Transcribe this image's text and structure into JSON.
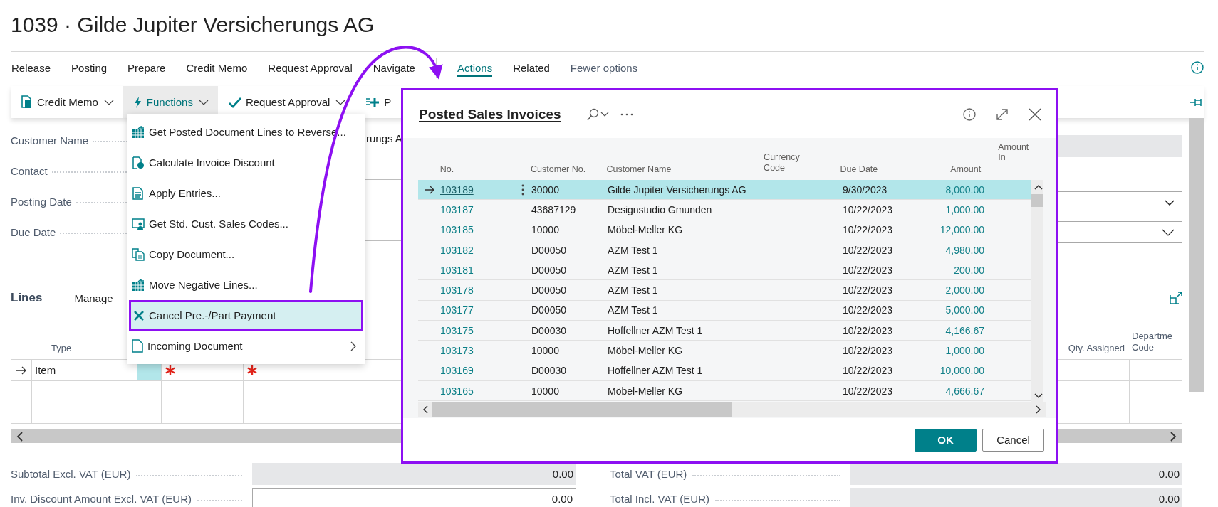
{
  "page_title": "1039 · Gilde Jupiter Versicherungs AG",
  "promoted_actions": [
    "Release",
    "Posting",
    "Prepare",
    "Credit Memo",
    "Request Approval",
    "Navigate"
  ],
  "action_tabs": [
    {
      "label": "Actions",
      "selected": true
    },
    {
      "label": "Related",
      "selected": false
    }
  ],
  "fewer_options": "Fewer options",
  "toolbar": [
    {
      "label": "Credit Memo",
      "selected": false,
      "dropdown": true
    },
    {
      "label": "Functions",
      "selected": true,
      "dropdown": true
    },
    {
      "label": "Request Approval",
      "selected": false,
      "dropdown": true
    },
    {
      "label": "P",
      "selected": false,
      "dropdown": false
    }
  ],
  "functions_menu": [
    {
      "label": "Get Posted Document Lines to Reverse...",
      "selected": false,
      "submenu": false
    },
    {
      "label": "Calculate Invoice Discount",
      "selected": false,
      "submenu": false
    },
    {
      "label": "Apply Entries...",
      "selected": false,
      "submenu": false
    },
    {
      "label": "Get Std. Cust. Sales Codes...",
      "selected": false,
      "submenu": false
    },
    {
      "label": "Copy Document...",
      "selected": false,
      "submenu": false
    },
    {
      "label": "Move Negative Lines...",
      "selected": false,
      "submenu": false
    },
    {
      "label": "Cancel Pre.-/Part Payment",
      "selected": true,
      "submenu": false
    },
    {
      "label": "Incoming Document",
      "selected": false,
      "submenu": true
    }
  ],
  "general_fields": [
    {
      "label": "Customer Name",
      "value": "rungs A"
    },
    {
      "label": "Contact"
    },
    {
      "label": "Posting Date"
    },
    {
      "label": "Due Date"
    }
  ],
  "lines": {
    "title": "Lines",
    "manage": "Manage",
    "type_column": "Type",
    "right_columns": [
      "Qty. Assigned",
      "Departme Code"
    ],
    "rows": [
      {
        "type": "Item",
        "selected": true
      }
    ]
  },
  "totals": [
    {
      "label": "Subtotal Excl. VAT (EUR)",
      "value": "0.00",
      "editable": false
    },
    {
      "label": "Total VAT (EUR)",
      "value": "0.00",
      "editable": false
    },
    {
      "label": "Inv. Discount Amount Excl. VAT (EUR)",
      "value": "0.00",
      "editable": true
    },
    {
      "label": "Total Incl. VAT (EUR)",
      "value": "0.00",
      "editable": false
    }
  ],
  "dialog": {
    "title": "Posted Sales Invoices",
    "columns": [
      "No.",
      "Customer No.",
      "Customer Name",
      "Currency Code",
      "Due Date",
      "Amount",
      "Amount In"
    ],
    "rows": [
      {
        "no": "103189",
        "customer_no": "30000",
        "customer_name": "Gilde Jupiter Versicherungs AG",
        "due_date": "9/30/2023",
        "amount": "8,000.00",
        "selected": true
      },
      {
        "no": "103187",
        "customer_no": "43687129",
        "customer_name": "Designstudio Gmunden",
        "due_date": "10/22/2023",
        "amount": "1,000.00",
        "selected": false
      },
      {
        "no": "103185",
        "customer_no": "10000",
        "customer_name": "Möbel-Meller KG",
        "due_date": "10/22/2023",
        "amount": "12,000.00",
        "selected": false
      },
      {
        "no": "103182",
        "customer_no": "D00050",
        "customer_name": "AZM Test 1",
        "due_date": "10/22/2023",
        "amount": "4,980.00",
        "selected": false
      },
      {
        "no": "103181",
        "customer_no": "D00050",
        "customer_name": "AZM Test 1",
        "due_date": "10/22/2023",
        "amount": "200.00",
        "selected": false
      },
      {
        "no": "103178",
        "customer_no": "D00050",
        "customer_name": "AZM Test 1",
        "due_date": "10/22/2023",
        "amount": "2,000.00",
        "selected": false
      },
      {
        "no": "103177",
        "customer_no": "D00050",
        "customer_name": "AZM Test 1",
        "due_date": "10/22/2023",
        "amount": "5,000.00",
        "selected": false
      },
      {
        "no": "103175",
        "customer_no": "D00030",
        "customer_name": "Hoffellner AZM Test 1",
        "due_date": "10/22/2023",
        "amount": "4,166.67",
        "selected": false
      },
      {
        "no": "103173",
        "customer_no": "10000",
        "customer_name": "Möbel-Meller KG",
        "due_date": "10/22/2023",
        "amount": "1,000.00",
        "selected": false
      },
      {
        "no": "103169",
        "customer_no": "D00030",
        "customer_name": "Hoffellner AZM Test 1",
        "due_date": "10/22/2023",
        "amount": "10,000.00",
        "selected": false
      },
      {
        "no": "103165",
        "customer_no": "10000",
        "customer_name": "Möbel-Meller KG",
        "due_date": "10/22/2023",
        "amount": "4,666.67",
        "selected": false
      }
    ],
    "buttons": [
      {
        "label": "OK",
        "kind": "primary"
      },
      {
        "label": "Cancel",
        "kind": "secondary"
      }
    ]
  }
}
